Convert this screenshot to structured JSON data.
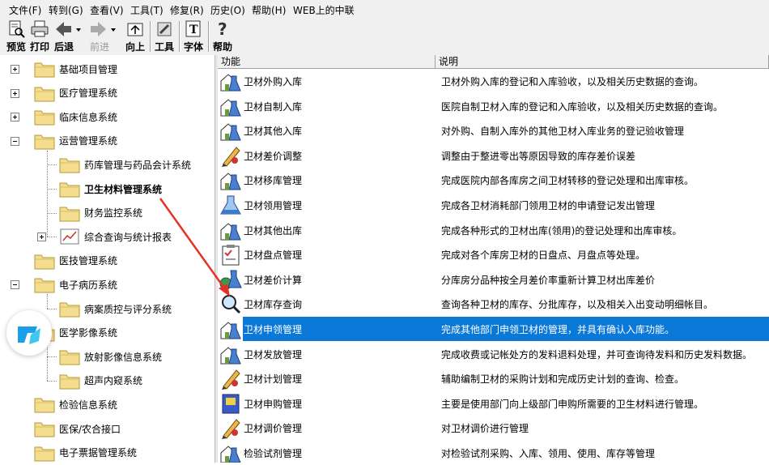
{
  "menu": [
    "文件(F)",
    "转到(G)",
    "查看(V)",
    "工具(T)",
    "修复(R)",
    "历史(O)",
    "帮助(H)",
    "WEB上的中联"
  ],
  "toolbar": {
    "preview": "预览",
    "print": "打印",
    "back": "后退",
    "forward": "前进",
    "up": "向上",
    "tools": "工具",
    "font": "字体",
    "help": "帮助"
  },
  "tree": [
    {
      "label": "基础项目管理",
      "level": 0,
      "toggle": "plus"
    },
    {
      "label": "医疗管理系统",
      "level": 0,
      "toggle": "plus"
    },
    {
      "label": "临床信息系统",
      "level": 0,
      "toggle": "plus"
    },
    {
      "label": "运营管理系统",
      "level": 0,
      "toggle": "minus"
    },
    {
      "label": "药库管理与药品会计系统",
      "level": 1,
      "toggle": ""
    },
    {
      "label": "卫生材料管理系统",
      "level": 1,
      "toggle": "",
      "selected": true
    },
    {
      "label": "财务监控系统",
      "level": 1,
      "toggle": ""
    },
    {
      "label": "综合查询与统计报表",
      "level": 1,
      "toggle": "plus"
    },
    {
      "label": "医技管理系统",
      "level": 0,
      "toggle": ""
    },
    {
      "label": "电子病历系统",
      "level": 0,
      "toggle": "minus"
    },
    {
      "label": "病案质控与评分系统",
      "level": 1,
      "toggle": ""
    },
    {
      "label": "医学影像系统",
      "level": 0,
      "toggle": ""
    },
    {
      "label": "放射影像信息系统",
      "level": 1,
      "toggle": ""
    },
    {
      "label": "超声内窥系统",
      "level": 1,
      "toggle": ""
    },
    {
      "label": "检验信息系统",
      "level": 0,
      "toggle": ""
    },
    {
      "label": "医保/农合接口",
      "level": 0,
      "toggle": ""
    },
    {
      "label": "电子票据管理系统",
      "level": 0,
      "toggle": ""
    }
  ],
  "columns": {
    "func": "功能",
    "desc": "说明"
  },
  "rows": [
    {
      "name": "卫材外购入库",
      "desc": "卫材外购入库的登记和入库验收，以及相关历史数据的查询。",
      "icon": "flask-house-icon"
    },
    {
      "name": "卫材自制入库",
      "desc": "医院自制卫材入库的登记和入库验收，以及相关历史数据的查询。",
      "icon": "flask-house-icon"
    },
    {
      "name": "卫材其他入库",
      "desc": "对外购、自制入库外的其他卫材入库业务的登记验收管理",
      "icon": "flask-house-icon"
    },
    {
      "name": "卫材差价调整",
      "desc": "调整由于整进零出等原因导致的库存差价误差",
      "icon": "pencil-tool-icon"
    },
    {
      "name": "卫材移库管理",
      "desc": "完成医院内部各库房之间卫材转移的登记处理和出库审核。",
      "icon": "flask-house-icon"
    },
    {
      "name": "卫材领用管理",
      "desc": "完成各卫材消耗部门领用卫材的申请登记发出管理",
      "icon": "flask-icon"
    },
    {
      "name": "卫材其他出库",
      "desc": "完成各种形式的卫材出库(领用)的登记处理和出库审核。",
      "icon": "flask-house-icon"
    },
    {
      "name": "卫材盘点管理",
      "desc": "完成对各个库房卫材的日盘点、月盘点等处理。",
      "icon": "clipboard-icon"
    },
    {
      "name": "卫材差价计算",
      "desc": "分库房分品种按全月差价率重新计算卫材出库差价",
      "icon": "flask-coins-icon"
    },
    {
      "name": "卫材库存查询",
      "desc": "查询各种卫材的库存、分批库存，以及相关入出变动明细帐目。",
      "icon": "magnifier-icon"
    },
    {
      "name": "卫材申领管理",
      "desc": "完成其他部门申领卫材的管理，并具有确认入库功能。",
      "icon": "flask-house-icon",
      "selected": true
    },
    {
      "name": "卫材发放管理",
      "desc": "完成收费或记帐处方的发料退料处理，并可查询待发料和历史发料数据。",
      "icon": "flask-house-icon"
    },
    {
      "name": "卫材计划管理",
      "desc": "辅助编制卫材的采购计划和完成历史计划的查询、检查。",
      "icon": "pencil-tool-icon"
    },
    {
      "name": "卫材申购管理",
      "desc": "主要是使用部门向上级部门申购所需要的卫生材料进行管理。",
      "icon": "book-icon"
    },
    {
      "name": "卫材调价管理",
      "desc": "对卫材调价进行管理",
      "icon": "pencil-tool-icon"
    },
    {
      "name": "检验试剂管理",
      "desc": "对检验试剂采购、入库、领用、使用、库存等管理",
      "icon": "flask-house-icon"
    }
  ]
}
